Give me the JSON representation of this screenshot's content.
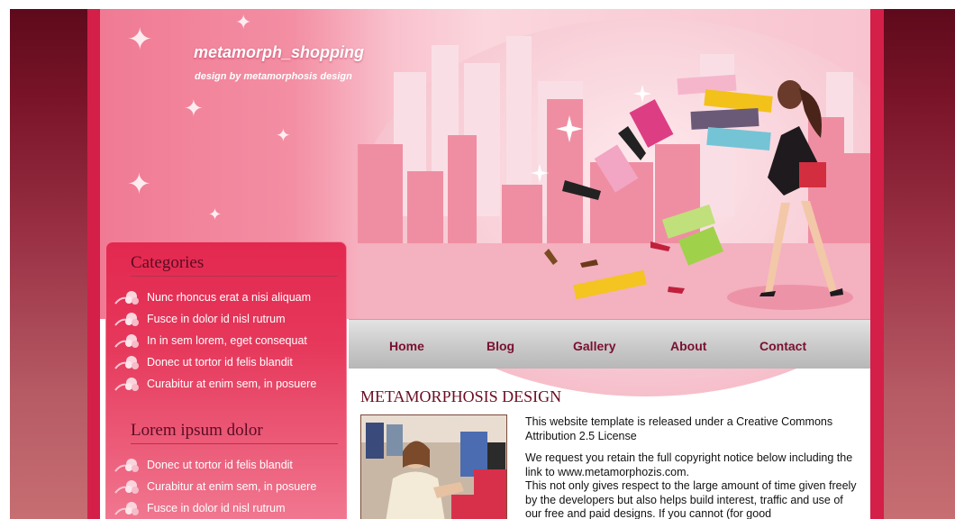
{
  "site": {
    "title": "metamorph_shopping",
    "subtitle": "design by metamorphosis design"
  },
  "nav": {
    "items": [
      {
        "label": "Home"
      },
      {
        "label": "Blog"
      },
      {
        "label": "Gallery"
      },
      {
        "label": "About"
      },
      {
        "label": "Contact"
      }
    ]
  },
  "sidebar": {
    "sections": [
      {
        "heading": "Categories",
        "items": [
          {
            "label": "Nunc rhoncus erat a nisi aliquam"
          },
          {
            "label": "Fusce in dolor id nisl rutrum"
          },
          {
            "label": "In in sem lorem, eget consequat"
          },
          {
            "label": "Donec ut tortor id felis blandit"
          },
          {
            "label": "Curabitur at enim sem, in posuere"
          }
        ]
      },
      {
        "heading": "Lorem ipsum dolor",
        "items": [
          {
            "label": "Donec ut tortor id felis blandit"
          },
          {
            "label": "Curabitur at enim sem, in posuere"
          },
          {
            "label": "Fusce in dolor id nisl rutrum"
          }
        ]
      }
    ]
  },
  "content": {
    "heading": "METAMORPHOSIS DESIGN",
    "paragraphs": [
      "This website template is released under a Creative Commons Attribution 2.5 License",
      "We request you retain the full copyright notice below including the link to www.metamorphozis.com.",
      "This not only gives respect to the large amount of time given freely by the developers but also helps build interest, traffic and use of our free and paid designs. If you cannot (for good"
    ]
  },
  "colors": {
    "accent": "#d41f48",
    "nav_text": "#7a1030",
    "heading": "#6c0d22"
  },
  "icons": {
    "list_bullet": "flower-icon",
    "header_decoration": "sparkle-icon"
  }
}
